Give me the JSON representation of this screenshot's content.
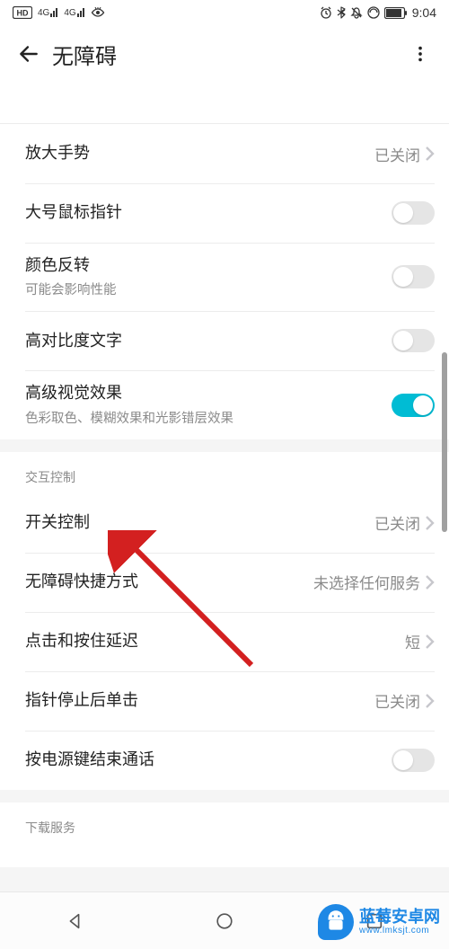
{
  "status": {
    "hd_badge": "HD",
    "signal1": "4G",
    "signal2": "4G",
    "time": "9:04"
  },
  "header": {
    "title": "无障碍"
  },
  "sections": [
    {
      "rows": [
        {
          "title": "放大手势",
          "value": "已关闭",
          "type": "link"
        },
        {
          "title": "大号鼠标指针",
          "type": "toggle",
          "on": false
        },
        {
          "title": "颜色反转",
          "sub": "可能会影响性能",
          "type": "toggle",
          "on": false
        },
        {
          "title": "高对比度文字",
          "type": "toggle",
          "on": false
        },
        {
          "title": "高级视觉效果",
          "sub": "色彩取色、模糊效果和光影错层效果",
          "type": "toggle",
          "on": true
        }
      ]
    },
    {
      "header": "交互控制",
      "rows": [
        {
          "title": "开关控制",
          "value": "已关闭",
          "type": "link"
        },
        {
          "title": "无障碍快捷方式",
          "value": "未选择任何服务",
          "type": "link"
        },
        {
          "title": "点击和按住延迟",
          "value": "短",
          "type": "link"
        },
        {
          "title": "指针停止后单击",
          "value": "已关闭",
          "type": "link"
        },
        {
          "title": "按电源键结束通话",
          "type": "toggle",
          "on": false
        }
      ]
    },
    {
      "header": "下载服务",
      "rows": []
    }
  ],
  "watermark": {
    "title": "蓝莓安卓网",
    "url": "www.lmksjt.com"
  }
}
